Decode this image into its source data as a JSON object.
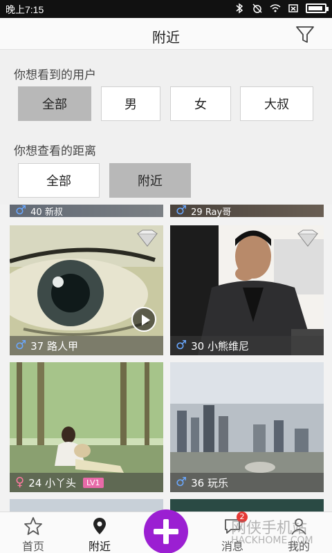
{
  "status_bar": {
    "time": "晚上7:15",
    "battery_level": 0.9
  },
  "header": {
    "title": "附近"
  },
  "filter_panel": {
    "gender_label": "你想看到的用户",
    "gender_options": [
      "全部",
      "男",
      "女",
      "大叔"
    ],
    "gender_selected": 0,
    "distance_label": "你想查看的距离",
    "distance_options": [
      "全部",
      "附近"
    ],
    "distance_selected": 1
  },
  "feed": {
    "partial_row": [
      "40 新叔",
      "29 Ray哥"
    ],
    "cards": [
      {
        "age_name": "37 路人甲",
        "gender": "male",
        "has_video": true,
        "has_badge": true
      },
      {
        "age_name": "30 小熊维尼",
        "gender": "male",
        "has_video": false,
        "has_badge": true
      },
      {
        "age_name": "24 小丫头",
        "gender": "female",
        "level": "LV1",
        "has_video": false,
        "has_badge": false
      },
      {
        "age_name": "36 玩乐",
        "gender": "male",
        "has_video": false,
        "has_badge": false
      }
    ]
  },
  "bottom_nav": {
    "items": [
      "首页",
      "附近",
      "消息",
      "我的"
    ],
    "active": 1,
    "message_count": "2"
  },
  "watermark": {
    "line1": "网侠手机站",
    "line2": "HACKHOME.COM"
  },
  "colors": {
    "accent": "#9b1fd2",
    "male": "#6aa8ff",
    "female": "#ff7aa0",
    "selected_option": "#b8b8b8"
  }
}
